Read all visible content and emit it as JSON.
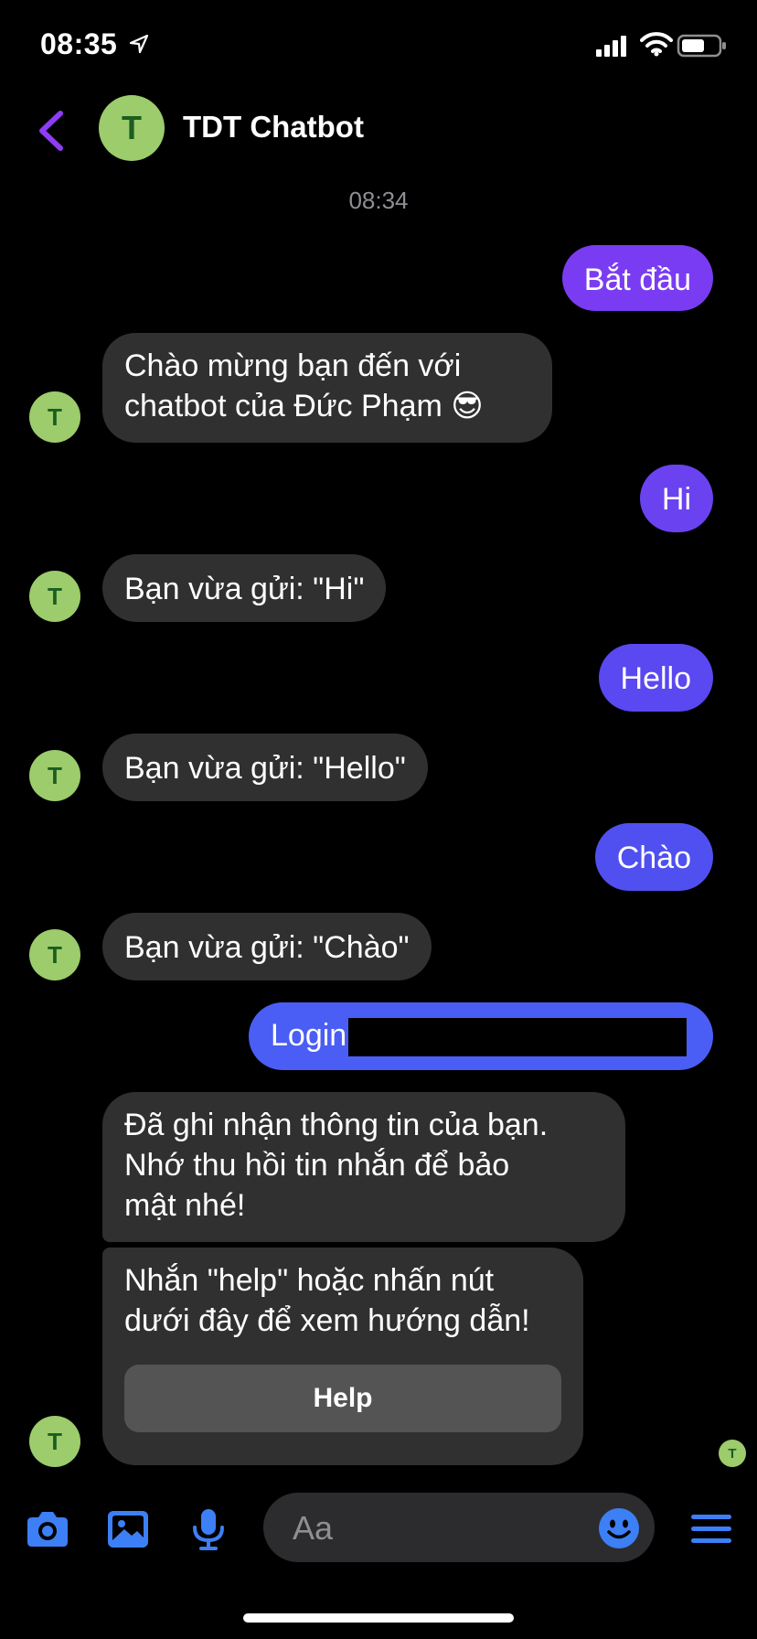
{
  "status_bar": {
    "time": "08:35"
  },
  "header": {
    "title": "TDT Chatbot",
    "avatar_letter": "T"
  },
  "timestamp": "08:34",
  "messages": {
    "m1": "Bắt đầu",
    "m2_line1": "Chào mừng bạn đến với",
    "m2_line2": "chatbot của Đức Phạm 😎",
    "m3": "Hi",
    "m4": "Bạn vừa gửi: \"Hi\"",
    "m5": "Hello",
    "m6": "Bạn vừa gửi: \"Hello\"",
    "m7": "Chào",
    "m8": "Bạn vừa gửi: \"Chào\"",
    "m9": "Login",
    "m10_line1": "Đã ghi nhận thông tin của bạn.",
    "m10_line2": "Nhớ thu hồi tin nhắn để bảo",
    "m10_line3": "mật nhé!",
    "m11_line1": "Nhắn \"help\" hoặc nhấn nút",
    "m11_line2": "dưới đây để xem hướng dẫn!",
    "help_button": "Help"
  },
  "avatar_letter": "T",
  "composer": {
    "placeholder": "Aa"
  },
  "colors": {
    "accent": "#8e3cf7",
    "bubble_purple": "#7a3cf2",
    "bubble_violet": "#6a42f0",
    "bubble_indigo": "#5050f0",
    "bubble_blue": "#4a5ef5",
    "incoming_bubble": "#303030",
    "icon_blue": "#3d7ff5",
    "avatar_green": "#9ccc6b"
  },
  "icons": [
    "location-arrow-icon",
    "signal-icon",
    "wifi-icon",
    "battery-icon",
    "back-chevron-icon",
    "camera-icon",
    "photo-icon",
    "microphone-icon",
    "emoji-icon",
    "menu-icon"
  ]
}
